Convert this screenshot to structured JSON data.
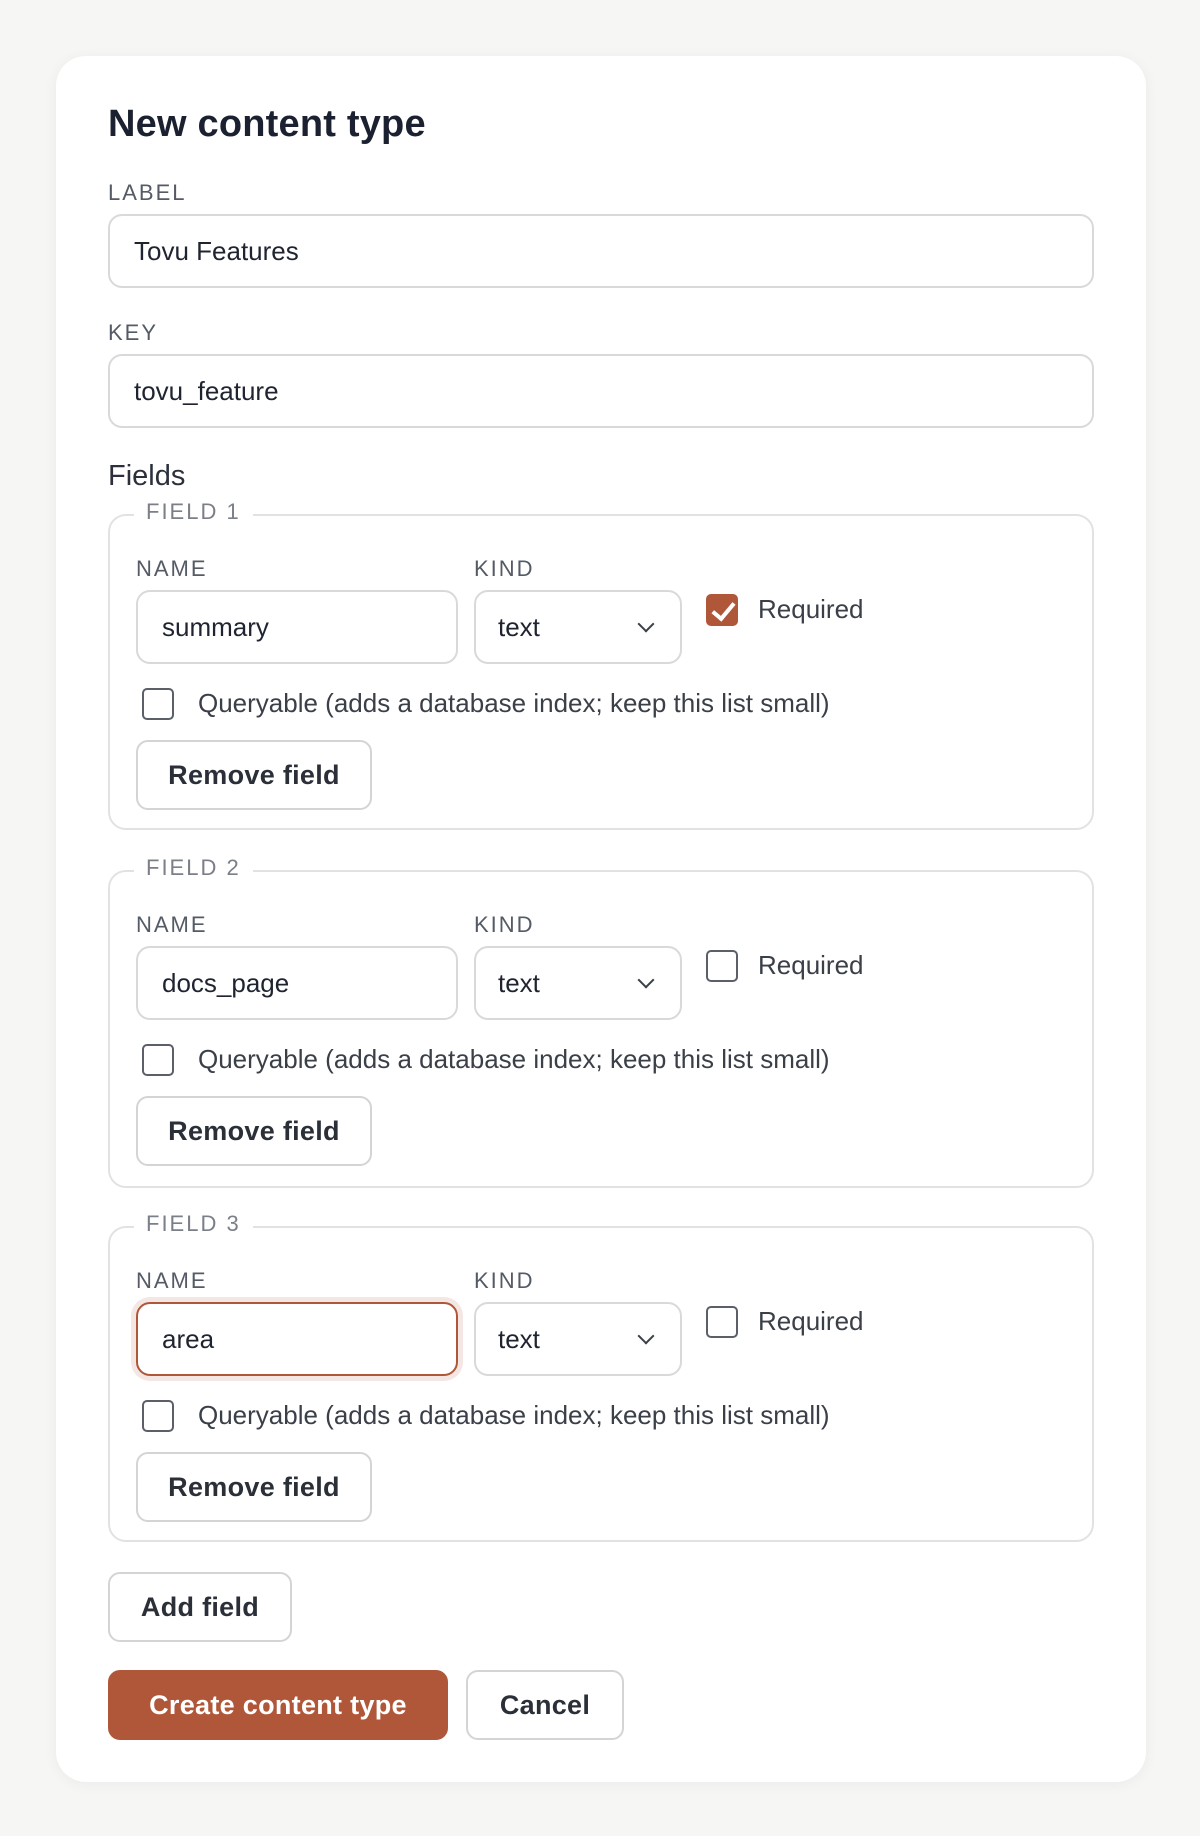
{
  "form": {
    "title": "New content type",
    "label_label": "LABEL",
    "label_value": "Tovu Features",
    "key_label": "KEY",
    "key_value": "tovu_feature",
    "fields_heading": "Fields"
  },
  "fields": [
    {
      "legend": "FIELD 1",
      "name_label": "NAME",
      "name_value": "summary",
      "kind_label": "KIND",
      "kind_value": "text",
      "required_label": "Required",
      "required_checked": true,
      "queryable_label": "Queryable (adds a database index; keep this list small)",
      "queryable_checked": false,
      "remove_label": "Remove field"
    },
    {
      "legend": "FIELD 2",
      "name_label": "NAME",
      "name_value": "docs_page",
      "kind_label": "KIND",
      "kind_value": "text",
      "required_label": "Required",
      "required_checked": false,
      "queryable_label": "Queryable (adds a database index; keep this list small)",
      "queryable_checked": false,
      "remove_label": "Remove field"
    },
    {
      "legend": "FIELD 3",
      "name_label": "NAME",
      "name_value": "area",
      "kind_label": "KIND",
      "kind_value": "text",
      "required_label": "Required",
      "required_checked": false,
      "queryable_label": "Queryable (adds a database index; keep this list small)",
      "queryable_checked": false,
      "remove_label": "Remove field"
    }
  ],
  "actions": {
    "add_field": "Add field",
    "create": "Create content type",
    "cancel": "Cancel"
  },
  "colors": {
    "accent": "#b0573a",
    "border": "#d9d9d9",
    "text": "#1f2430"
  }
}
